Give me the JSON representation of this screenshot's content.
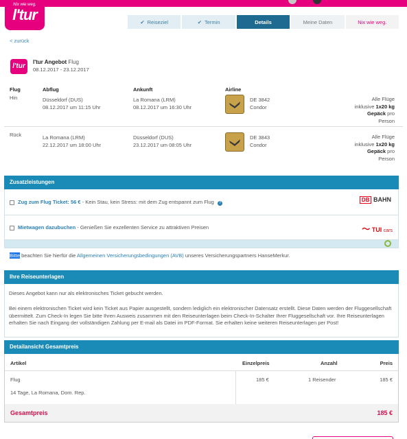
{
  "brand": {
    "slogan": "Nix wie weg.",
    "name": "l'tur",
    "pink": "#e6007e",
    "blue": "#1a8bb7"
  },
  "steps": [
    "Reiseziel",
    "Termin",
    "Details",
    "Meine Daten",
    "Nix wie weg."
  ],
  "back_link": "< zurück",
  "offer": {
    "title": "l'tur Angebot",
    "type": "Flug",
    "dates": "08.12.2017 - 23.12.2017"
  },
  "flights": {
    "headers": {
      "flug": "Flug",
      "abflug": "Abflug",
      "ankunft": "Ankunft",
      "airline": "Airline"
    },
    "rows": [
      {
        "dir": "Hin",
        "from_airport": "Düsseldorf (DUS)",
        "from_time": "08.12.2017 um 11:15 Uhr",
        "to_airport": "La Romana (LRM)",
        "to_time": "08.12.2017 um 16:30 Uhr",
        "flight_no": "DE 3842",
        "carrier": "Condor",
        "bag1": "Alle Flüge",
        "bag2": "inklusive",
        "bag_qty": "1x20 kg",
        "bag3": "Gepäck",
        "bag4": "pro",
        "bag5": "Person"
      },
      {
        "dir": "Rück",
        "from_airport": "La Romana (LRM)",
        "from_time": "22.12.2017 um 18:00 Uhr",
        "to_airport": "Düsseldorf (DUS)",
        "to_time": "23.12.2017 um 08:05 Uhr",
        "flight_no": "DE 3843",
        "carrier": "Condor",
        "bag1": "Alle Flüge",
        "bag2": "inklusive",
        "bag_qty": "1x20 kg",
        "bag3": "Gepäck",
        "bag4": "pro",
        "bag5": "Person"
      }
    ]
  },
  "extras": {
    "title": "Zusatzleistungen",
    "train_link": "Zug zum Flug Ticket: 56 €",
    "train_text": " - Kein Stau, kein Stress: mit dem Zug entspannt zum Flug",
    "db_logo": "DB",
    "db_text": "BAHN",
    "car_link": "Mietwagen dazubuchen",
    "car_text": " - Genießen Sie exzellenten Service zu attraktiven Preisen",
    "tui_logo": "TUI",
    "tui_text": "cars",
    "insurance_sel": "Bitte",
    "insurance_pre": " beachten Sie hierfür die ",
    "insurance_link": "Allgemeinen Versicherungsbedingungen (AVB)",
    "insurance_post": " unseres Versicherungspartners HanseMerkur."
  },
  "documents": {
    "title": "Ihre Reiseunterlagen",
    "p1": "Dieses Angebot kann nur als elektronisches Ticket gebucht werden.",
    "p2": "Bei einem elektronischen Ticket wird kein Ticket aus Papier ausgestellt, sondern lediglich ein elektronischer Datensatz erstellt. Diese Daten werden der Fluggesellschaft übermittelt. Zum Check-In legen Sie bitte Ihren Ausweis zusammen mit den Reiseunterlagen beim Check-In-Schalter Ihrer Fluggesellschaft vor. Ihre Reiseunterlagen erhalten Sie nach Eingang der vollständigen Zahlung per E-mail als Datei im PDF-Format. Sie erhalten keine weiteren Reiseunterlagen per Post!"
  },
  "price": {
    "title": "Detailansicht Gesamtpreis",
    "headers": {
      "artikel": "Artikel",
      "einzelpreis": "Einzelpreis",
      "anzahl": "Anzahl",
      "preis": "Preis"
    },
    "item": {
      "name": "Flug",
      "desc": "14 Tage, La Romana, Dom. Rep.",
      "unit": "185 €",
      "qty": "1 Reisender",
      "total": "185 €"
    },
    "total_label": "Gesamtpreis",
    "total_value": "185 €"
  }
}
